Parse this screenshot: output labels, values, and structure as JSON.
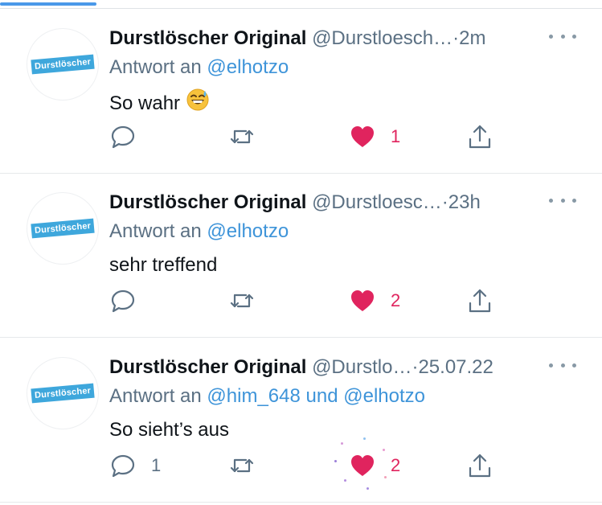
{
  "tweets": [
    {
      "author_name": "Durstlöscher Original",
      "handle": "@Durstloesch…",
      "separator": "·",
      "time": "2m",
      "reply_prefix": "Antwort an",
      "mentions": [
        "@elhotzo"
      ],
      "mention_joiner": "",
      "text": "So wahr",
      "emoji": "sweat-smile-emoji",
      "reply_count": "",
      "like_count": "1",
      "logo_text": "Durstlöscher"
    },
    {
      "author_name": "Durstlöscher Original",
      "handle": "@Durstloesc…",
      "separator": "·",
      "time": "23h",
      "reply_prefix": "Antwort an",
      "mentions": [
        "@elhotzo"
      ],
      "mention_joiner": "",
      "text": "sehr treffend",
      "emoji": "",
      "reply_count": "",
      "like_count": "2",
      "logo_text": "Durstlöscher"
    },
    {
      "author_name": "Durstlöscher Original",
      "handle": "@Durstlo…",
      "separator": "·",
      "time": "25.07.22",
      "reply_prefix": "Antwort an",
      "mentions": [
        "@him_648",
        "@elhotzo"
      ],
      "mention_joiner": "und",
      "text": "So sieht’s aus",
      "emoji": "",
      "reply_count": "1",
      "like_count": "2",
      "logo_text": "Durstlöscher"
    }
  ],
  "icons": {
    "reply": "reply-icon",
    "retweet": "retweet-icon",
    "like": "heart-icon",
    "share": "share-icon",
    "more": "more-icon"
  },
  "colors": {
    "name": "#0f1419",
    "secondary": "#5b7083",
    "link": "#3e94d9",
    "like_active": "#e0245e",
    "tab_indicator": "#4a99e9",
    "logo_background": "#3ea7dc"
  }
}
